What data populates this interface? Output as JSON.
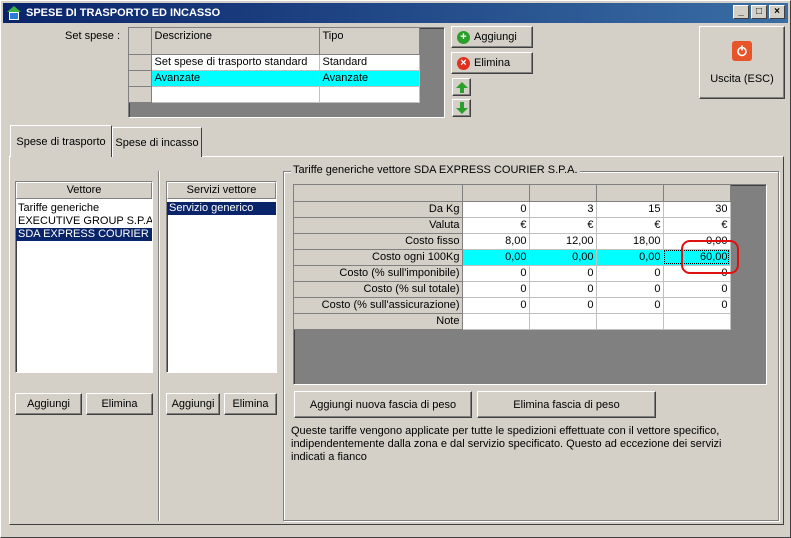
{
  "window": {
    "title": "SPESE DI TRASPORTO ED INCASSO",
    "controls": [
      "_",
      "□",
      "×"
    ]
  },
  "set_spese": {
    "label": "Set spese :",
    "columns": [
      "Descrizione",
      "Tipo"
    ],
    "rows": [
      {
        "descrizione": "Set spese di trasporto standard",
        "tipo": "Standard"
      },
      {
        "descrizione": "Avanzate",
        "tipo": "Avanzate"
      }
    ],
    "selected_row": 1
  },
  "toolbar": {
    "aggiungi": "Aggiungi",
    "elimina": "Elimina",
    "uscita": "Uscita (ESC)"
  },
  "tabs": [
    "Spese di trasporto",
    "Spese di incasso"
  ],
  "vettore": {
    "header": "Vettore",
    "items": [
      "Tariffe generiche",
      "EXECUTIVE GROUP S.P.A.",
      "SDA EXPRESS COURIER S"
    ],
    "selected": 2,
    "add": "Aggiungi",
    "delete": "Elimina"
  },
  "servizi": {
    "header": "Servizi vettore",
    "items": [
      "Servizio generico"
    ],
    "selected": 0,
    "add": "Aggiungi",
    "delete": "Elimina"
  },
  "tariffe": {
    "title": "Tariffe generiche vettore SDA EXPRESS COURIER S.P.A.",
    "rows": [
      {
        "label": "Da Kg",
        "values": [
          "0",
          "3",
          "15",
          "30"
        ]
      },
      {
        "label": "Valuta",
        "values": [
          "€",
          "€",
          "€",
          "€"
        ]
      },
      {
        "label": "Costo fisso",
        "values": [
          "8,00",
          "12,00",
          "18,00",
          "0,00"
        ]
      },
      {
        "label": "Costo ogni 100Kg",
        "values": [
          "0,00",
          "0,00",
          "0,00",
          "60,00"
        ]
      },
      {
        "label": "Costo (% sull'imponibile)",
        "values": [
          "0",
          "0",
          "0",
          "0"
        ]
      },
      {
        "label": "Costo (% sul totale)",
        "values": [
          "0",
          "0",
          "0",
          "0"
        ]
      },
      {
        "label": "Costo (% sull'assicurazione)",
        "values": [
          "0",
          "0",
          "0",
          "0"
        ]
      },
      {
        "label": "Note",
        "values": [
          "",
          "",
          "",
          ""
        ]
      }
    ],
    "highlight_row": 3,
    "add_band": "Aggiungi nuova fascia di peso",
    "delete_band": "Elimina fascia di peso",
    "info": "Queste tariffe vengono applicate per tutte le spedizioni effettuate con il vettore specifico, indipendentemente dalla zona e dal servizio specificato. Questo ad eccezione dei servizi indicati a fianco"
  },
  "colors": {
    "title_bar": "#0a246a",
    "selection_cyan": "#00ffff",
    "list_selection": "#0a246a",
    "annotation_red": "#e01010"
  }
}
